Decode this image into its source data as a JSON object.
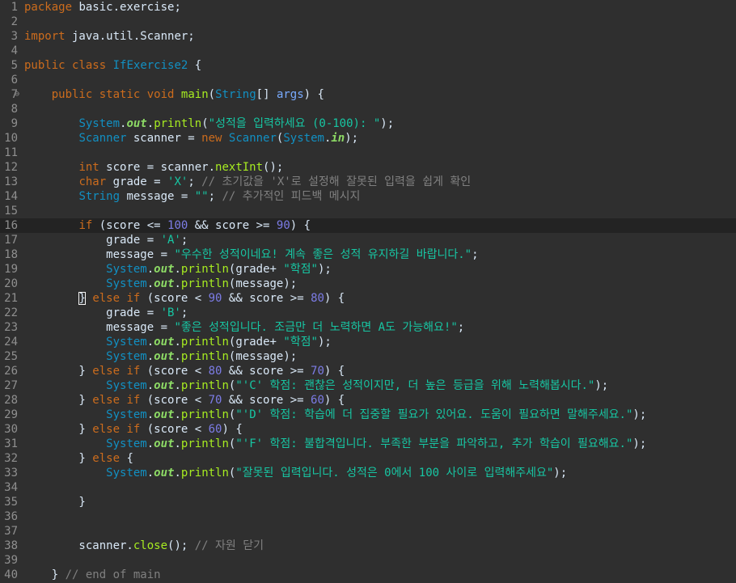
{
  "editor": {
    "lines": [
      {
        "n": "1",
        "tokens": [
          {
            "c": "kw",
            "t": "package"
          },
          {
            "t": " basic.exercise;"
          }
        ]
      },
      {
        "n": "2",
        "tokens": []
      },
      {
        "n": "3",
        "tokens": [
          {
            "c": "kw",
            "t": "import"
          },
          {
            "t": " java.util.Scanner;"
          }
        ]
      },
      {
        "n": "4",
        "tokens": []
      },
      {
        "n": "5",
        "tokens": [
          {
            "c": "kw",
            "t": "public"
          },
          {
            "t": " "
          },
          {
            "c": "kw",
            "t": "class"
          },
          {
            "t": " "
          },
          {
            "c": "cls",
            "t": "IfExercise2"
          },
          {
            "t": " {"
          }
        ]
      },
      {
        "n": "6",
        "tokens": []
      },
      {
        "n": "7",
        "fold": "⊖",
        "tokens": [
          {
            "t": "    "
          },
          {
            "c": "kw",
            "t": "public"
          },
          {
            "t": " "
          },
          {
            "c": "kw",
            "t": "static"
          },
          {
            "t": " "
          },
          {
            "c": "kw",
            "t": "void"
          },
          {
            "t": " "
          },
          {
            "c": "mth",
            "t": "main"
          },
          {
            "t": "("
          },
          {
            "c": "cls",
            "t": "String"
          },
          {
            "t": "[] "
          },
          {
            "c": "var",
            "t": "args"
          },
          {
            "t": ") {"
          }
        ]
      },
      {
        "n": "8",
        "tokens": []
      },
      {
        "n": "9",
        "tokens": [
          {
            "t": "        "
          },
          {
            "c": "cls",
            "t": "System"
          },
          {
            "t": "."
          },
          {
            "c": "fld",
            "t": "out"
          },
          {
            "t": "."
          },
          {
            "c": "mth",
            "t": "println"
          },
          {
            "t": "("
          },
          {
            "c": "str",
            "t": "\"성적을 입력하세요 (0-100): \""
          },
          {
            "t": ");"
          }
        ]
      },
      {
        "n": "10",
        "tokens": [
          {
            "t": "        "
          },
          {
            "c": "cls",
            "t": "Scanner"
          },
          {
            "t": " scanner = "
          },
          {
            "c": "kw",
            "t": "new"
          },
          {
            "t": " "
          },
          {
            "c": "cls",
            "t": "Scanner"
          },
          {
            "t": "("
          },
          {
            "c": "cls",
            "t": "System"
          },
          {
            "t": "."
          },
          {
            "c": "fld",
            "t": "in"
          },
          {
            "t": ");"
          }
        ]
      },
      {
        "n": "11",
        "tokens": []
      },
      {
        "n": "12",
        "tokens": [
          {
            "t": "        "
          },
          {
            "c": "kw",
            "t": "int"
          },
          {
            "t": " score = scanner."
          },
          {
            "c": "mth",
            "t": "nextInt"
          },
          {
            "t": "();"
          }
        ]
      },
      {
        "n": "13",
        "tokens": [
          {
            "t": "        "
          },
          {
            "c": "kw",
            "t": "char"
          },
          {
            "t": " grade = "
          },
          {
            "c": "str",
            "t": "'X'"
          },
          {
            "t": "; "
          },
          {
            "c": "cmt",
            "t": "// 초기값을 'X'로 설정해 잘못된 입력을 쉽게 확인"
          }
        ]
      },
      {
        "n": "14",
        "tokens": [
          {
            "t": "        "
          },
          {
            "c": "cls",
            "t": "String"
          },
          {
            "t": " message = "
          },
          {
            "c": "str",
            "t": "\"\""
          },
          {
            "t": "; "
          },
          {
            "c": "cmt",
            "t": "// 추가적인 피드백 메시지"
          }
        ]
      },
      {
        "n": "15",
        "tokens": []
      },
      {
        "n": "16",
        "current": true,
        "tokens": [
          {
            "t": "        "
          },
          {
            "c": "kw",
            "t": "if"
          },
          {
            "t": " (score <= "
          },
          {
            "c": "num",
            "t": "100"
          },
          {
            "t": " && score >= "
          },
          {
            "c": "num",
            "t": "90"
          },
          {
            "t": ") {"
          }
        ]
      },
      {
        "n": "17",
        "tokens": [
          {
            "t": "            grade = "
          },
          {
            "c": "str",
            "t": "'A'"
          },
          {
            "t": ";"
          }
        ]
      },
      {
        "n": "18",
        "tokens": [
          {
            "t": "            message = "
          },
          {
            "c": "str",
            "t": "\"우수한 성적이네요! 계속 좋은 성적 유지하길 바랍니다.\""
          },
          {
            "t": ";"
          }
        ]
      },
      {
        "n": "19",
        "tokens": [
          {
            "t": "            "
          },
          {
            "c": "cls",
            "t": "System"
          },
          {
            "t": "."
          },
          {
            "c": "fld",
            "t": "out"
          },
          {
            "t": "."
          },
          {
            "c": "mth",
            "t": "println"
          },
          {
            "t": "(grade+ "
          },
          {
            "c": "str",
            "t": "\"학점\""
          },
          {
            "t": ");"
          }
        ]
      },
      {
        "n": "20",
        "tokens": [
          {
            "t": "            "
          },
          {
            "c": "cls",
            "t": "System"
          },
          {
            "t": "."
          },
          {
            "c": "fld",
            "t": "out"
          },
          {
            "t": "."
          },
          {
            "c": "mth",
            "t": "println"
          },
          {
            "t": "(message);"
          }
        ]
      },
      {
        "n": "21",
        "tokens": [
          {
            "t": "        "
          },
          {
            "c": "brk",
            "t": "}"
          },
          {
            "t": " "
          },
          {
            "c": "kw",
            "t": "else"
          },
          {
            "t": " "
          },
          {
            "c": "kw",
            "t": "if"
          },
          {
            "t": " (score < "
          },
          {
            "c": "num",
            "t": "90"
          },
          {
            "t": " && score >= "
          },
          {
            "c": "num",
            "t": "80"
          },
          {
            "t": ") {"
          }
        ]
      },
      {
        "n": "22",
        "tokens": [
          {
            "t": "            grade = "
          },
          {
            "c": "str",
            "t": "'B'"
          },
          {
            "t": ";"
          }
        ]
      },
      {
        "n": "23",
        "tokens": [
          {
            "t": "            message = "
          },
          {
            "c": "str",
            "t": "\"좋은 성적입니다. 조금만 더 노력하면 A도 가능해요!\""
          },
          {
            "t": ";"
          }
        ]
      },
      {
        "n": "24",
        "tokens": [
          {
            "t": "            "
          },
          {
            "c": "cls",
            "t": "System"
          },
          {
            "t": "."
          },
          {
            "c": "fld",
            "t": "out"
          },
          {
            "t": "."
          },
          {
            "c": "mth",
            "t": "println"
          },
          {
            "t": "(grade+ "
          },
          {
            "c": "str",
            "t": "\"학점\""
          },
          {
            "t": ");"
          }
        ]
      },
      {
        "n": "25",
        "tokens": [
          {
            "t": "            "
          },
          {
            "c": "cls",
            "t": "System"
          },
          {
            "t": "."
          },
          {
            "c": "fld",
            "t": "out"
          },
          {
            "t": "."
          },
          {
            "c": "mth",
            "t": "println"
          },
          {
            "t": "(message);"
          }
        ]
      },
      {
        "n": "26",
        "tokens": [
          {
            "t": "        } "
          },
          {
            "c": "kw",
            "t": "else"
          },
          {
            "t": " "
          },
          {
            "c": "kw",
            "t": "if"
          },
          {
            "t": " (score < "
          },
          {
            "c": "num",
            "t": "80"
          },
          {
            "t": " && score >= "
          },
          {
            "c": "num",
            "t": "70"
          },
          {
            "t": ") {"
          }
        ]
      },
      {
        "n": "27",
        "tokens": [
          {
            "t": "            "
          },
          {
            "c": "cls",
            "t": "System"
          },
          {
            "t": "."
          },
          {
            "c": "fld",
            "t": "out"
          },
          {
            "t": "."
          },
          {
            "c": "mth",
            "t": "println"
          },
          {
            "t": "("
          },
          {
            "c": "str",
            "t": "\"'C' 학점: 괜찮은 성적이지만, 더 높은 등급을 위해 노력해봅시다.\""
          },
          {
            "t": ");"
          }
        ]
      },
      {
        "n": "28",
        "tokens": [
          {
            "t": "        } "
          },
          {
            "c": "kw",
            "t": "else"
          },
          {
            "t": " "
          },
          {
            "c": "kw",
            "t": "if"
          },
          {
            "t": " (score < "
          },
          {
            "c": "num",
            "t": "70"
          },
          {
            "t": " && score >= "
          },
          {
            "c": "num",
            "t": "60"
          },
          {
            "t": ") {"
          }
        ]
      },
      {
        "n": "29",
        "tokens": [
          {
            "t": "            "
          },
          {
            "c": "cls",
            "t": "System"
          },
          {
            "t": "."
          },
          {
            "c": "fld",
            "t": "out"
          },
          {
            "t": "."
          },
          {
            "c": "mth",
            "t": "println"
          },
          {
            "t": "("
          },
          {
            "c": "str",
            "t": "\"'D' 학점: 학습에 더 집중할 필요가 있어요. 도움이 필요하면 말해주세요.\""
          },
          {
            "t": ");"
          }
        ]
      },
      {
        "n": "30",
        "tokens": [
          {
            "t": "        } "
          },
          {
            "c": "kw",
            "t": "else"
          },
          {
            "t": " "
          },
          {
            "c": "kw",
            "t": "if"
          },
          {
            "t": " (score < "
          },
          {
            "c": "num",
            "t": "60"
          },
          {
            "t": ") {"
          }
        ]
      },
      {
        "n": "31",
        "tokens": [
          {
            "t": "            "
          },
          {
            "c": "cls",
            "t": "System"
          },
          {
            "t": "."
          },
          {
            "c": "fld",
            "t": "out"
          },
          {
            "t": "."
          },
          {
            "c": "mth",
            "t": "println"
          },
          {
            "t": "("
          },
          {
            "c": "str",
            "t": "\"'F' 학점: 불합격입니다. 부족한 부분을 파악하고, 추가 학습이 필요해요.\""
          },
          {
            "t": ");"
          }
        ]
      },
      {
        "n": "32",
        "tokens": [
          {
            "t": "        } "
          },
          {
            "c": "kw",
            "t": "else"
          },
          {
            "t": " {"
          }
        ]
      },
      {
        "n": "33",
        "tokens": [
          {
            "t": "            "
          },
          {
            "c": "cls",
            "t": "System"
          },
          {
            "t": "."
          },
          {
            "c": "fld",
            "t": "out"
          },
          {
            "t": "."
          },
          {
            "c": "mth",
            "t": "println"
          },
          {
            "t": "("
          },
          {
            "c": "str",
            "t": "\"잘못된 입력입니다. 성적은 0에서 100 사이로 입력해주세요\""
          },
          {
            "t": ");"
          }
        ]
      },
      {
        "n": "34",
        "tokens": []
      },
      {
        "n": "35",
        "tokens": [
          {
            "t": "        }"
          }
        ]
      },
      {
        "n": "36",
        "tokens": []
      },
      {
        "n": "37",
        "tokens": []
      },
      {
        "n": "38",
        "tokens": [
          {
            "t": "        scanner."
          },
          {
            "c": "mth",
            "t": "close"
          },
          {
            "t": "(); "
          },
          {
            "c": "cmt",
            "t": "// 자원 닫기"
          }
        ]
      },
      {
        "n": "39",
        "tokens": []
      },
      {
        "n": "40",
        "tokens": [
          {
            "t": "    } "
          },
          {
            "c": "cmt",
            "t": "// end of main"
          }
        ]
      }
    ]
  }
}
